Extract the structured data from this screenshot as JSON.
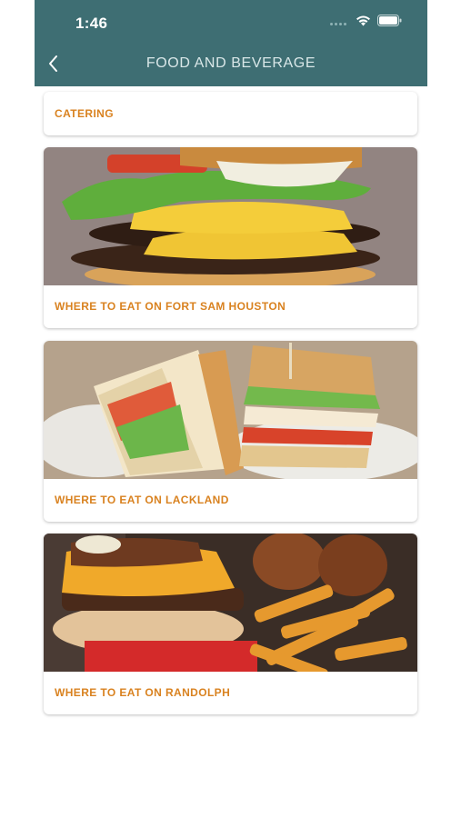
{
  "status_bar": {
    "time": "1:46"
  },
  "header": {
    "title": "FOOD AND BEVERAGE"
  },
  "cards": [
    {
      "label": "CATERING"
    },
    {
      "label": "WHERE TO EAT ON FORT SAM HOUSTON",
      "image": "burger-photo"
    },
    {
      "label": "WHERE TO EAT ON LACKLAND",
      "image": "club-sandwich-photo"
    },
    {
      "label": "WHERE TO EAT ON RANDOLPH",
      "image": "burger-fries-photo"
    }
  ],
  "colors": {
    "header_bg": "#3e6e73",
    "accent_text": "#d98220",
    "page_bg": "#ffffff"
  }
}
